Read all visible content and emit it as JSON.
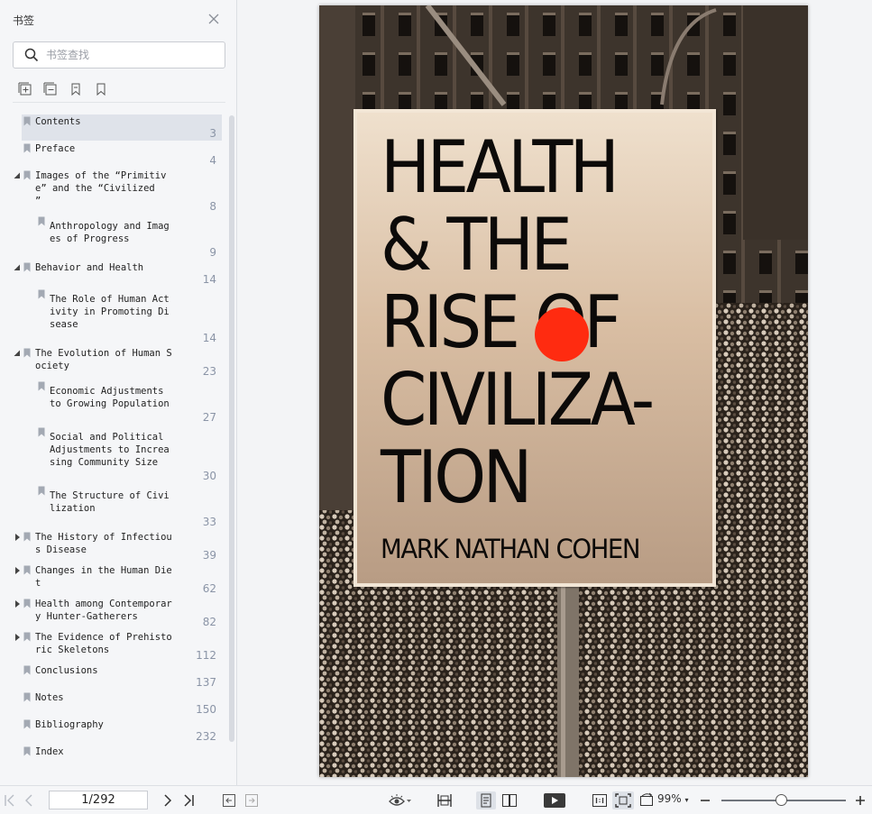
{
  "sidebar": {
    "title": "书签",
    "search_placeholder": "书签查找",
    "bookmarks": [
      {
        "label": "Contents",
        "page": "3",
        "level": 0,
        "arrow": "none",
        "active": true
      },
      {
        "label": "Preface",
        "page": "4",
        "level": 0,
        "arrow": "none"
      },
      {
        "label": "Images of the “Primitiv\ne” and the “Civilized\n”",
        "page": "8",
        "level": 0,
        "arrow": "expanded"
      },
      {
        "label": "Anthropology and Imag\nes of Progress",
        "page": "9",
        "level": 1,
        "arrow": "none"
      },
      {
        "label": "Behavior and Health",
        "page": "14",
        "level": 0,
        "arrow": "expanded"
      },
      {
        "label": "The Role of Human Act\nivity in Promoting Di\nsease",
        "page": "14",
        "level": 1,
        "arrow": "none"
      },
      {
        "label": "The Evolution of Human S\nociety",
        "page": "23",
        "level": 0,
        "arrow": "expanded"
      },
      {
        "label": "Economic Adjustments\nto Growing Population",
        "page": "27",
        "level": 1,
        "arrow": "none"
      },
      {
        "label": "Social and Political\nAdjustments to Increa\nsing Community Size",
        "page": "30",
        "level": 1,
        "arrow": "none"
      },
      {
        "label": "The Structure of Civi\nlization",
        "page": "33",
        "level": 1,
        "arrow": "none"
      },
      {
        "label": "The History of Infectiou\ns Disease",
        "page": "39",
        "level": 0,
        "arrow": "collapsed"
      },
      {
        "label": "Changes in the Human Die\nt",
        "page": "62",
        "level": 0,
        "arrow": "collapsed"
      },
      {
        "label": "Health among Contemporar\ny Hunter-Gatherers",
        "page": "82",
        "level": 0,
        "arrow": "collapsed"
      },
      {
        "label": "The Evidence of Prehisto\nric Skeletons",
        "page": "112",
        "level": 0,
        "arrow": "collapsed"
      },
      {
        "label": "Conclusions",
        "page": "137",
        "level": 0,
        "arrow": "none"
      },
      {
        "label": "Notes",
        "page": "150",
        "level": 0,
        "arrow": "none"
      },
      {
        "label": "Bibliography",
        "page": "232",
        "level": 0,
        "arrow": "none"
      },
      {
        "label": "Index",
        "page": "",
        "level": 0,
        "arrow": "none"
      }
    ]
  },
  "cover": {
    "title_lines": [
      "HEALTH",
      "& THE",
      "RISE OF",
      "CIVILIZA-",
      "TION"
    ],
    "author": "MARK NATHAN COHEN",
    "accent_color": "#ff2b10"
  },
  "bottombar": {
    "page_indicator": "1/292",
    "zoom": "99%",
    "zoom_fraction": 0.48
  },
  "icons": [
    "close-icon",
    "search-icon",
    "add-bookmark-icon",
    "remove-bookmark-icon",
    "bookmark-icon",
    "bookmark-outline-icon",
    "first-page-icon",
    "prev-page-icon",
    "next-page-icon",
    "last-page-icon",
    "back-icon",
    "forward-icon",
    "eye-icon",
    "fit-width-icon",
    "single-page-icon",
    "two-page-icon",
    "play-icon",
    "actual-size-icon",
    "fit-page-icon",
    "rotate-icon",
    "zoom-out-icon",
    "zoom-in-icon"
  ]
}
